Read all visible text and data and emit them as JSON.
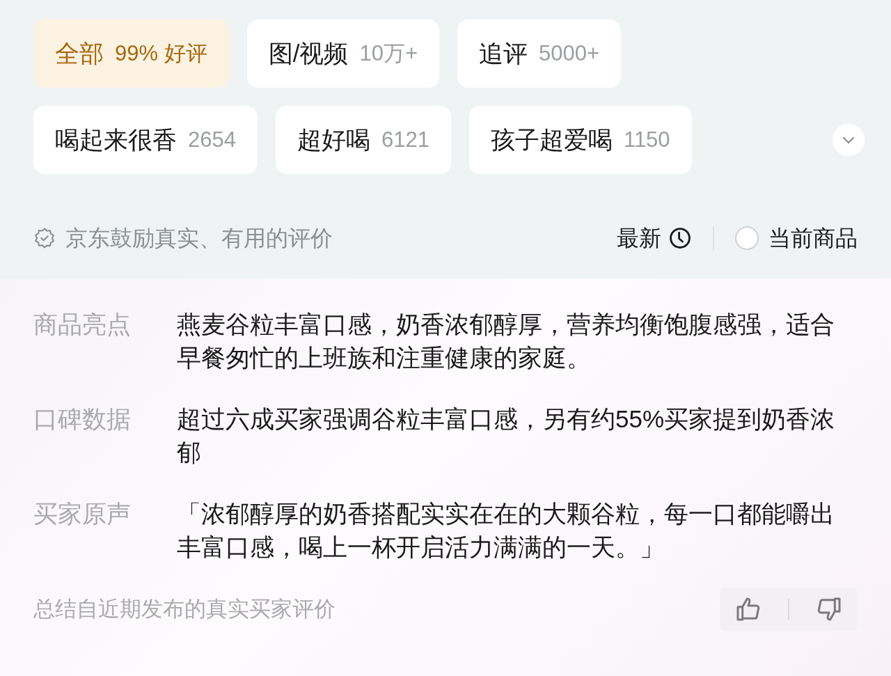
{
  "filters": [
    {
      "label": "全部",
      "count": "99% 好评",
      "selected": true
    },
    {
      "label": "图/视频",
      "count": "10万+",
      "selected": false
    },
    {
      "label": "追评",
      "count": "5000+",
      "selected": false
    },
    {
      "label": "喝起来很香",
      "count": "2654",
      "selected": false
    },
    {
      "label": "超好喝",
      "count": "6121",
      "selected": false
    },
    {
      "label": "孩子超爱喝",
      "count": "1150",
      "selected": false
    }
  ],
  "notice": "京东鼓励真实、有用的评价",
  "sort": {
    "label": "最新"
  },
  "current_product": {
    "label": "当前商品",
    "checked": false
  },
  "summary": [
    {
      "label": "商品亮点",
      "text": "燕麦谷粒丰富口感，奶香浓郁醇厚，营养均衡饱腹感强，适合早餐匆忙的上班族和注重健康的家庭。"
    },
    {
      "label": "口碑数据",
      "text": "超过六成买家强调谷粒丰富口感，另有约55%买家提到奶香浓郁"
    },
    {
      "label": "买家原声",
      "text": "「浓郁醇厚的奶香搭配实实在在的大颗谷粒，每一口都能嚼出丰富口感，喝上一杯开启活力满满的一天。」"
    }
  ],
  "footer": "总结自近期发布的真实买家评价"
}
